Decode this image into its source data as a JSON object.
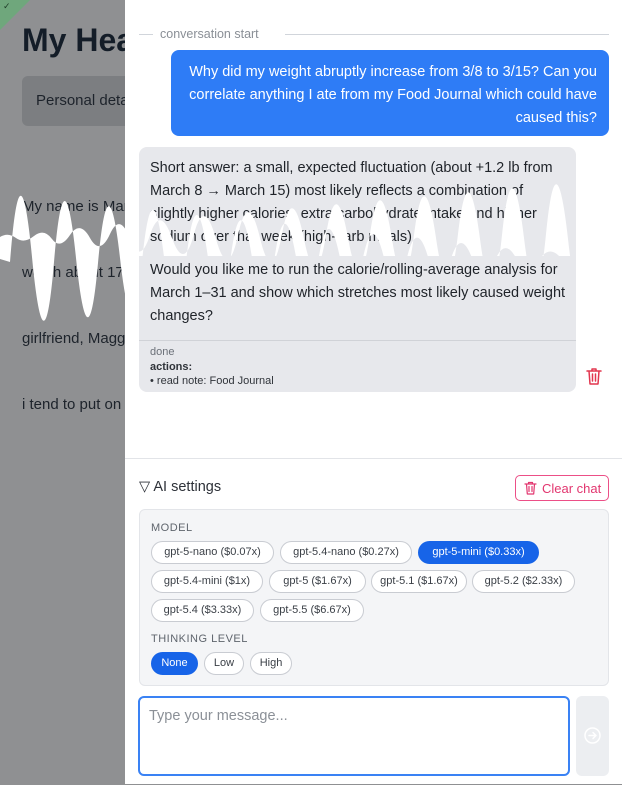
{
  "background_page": {
    "title": "My Hea",
    "tab_label": "Personal deta",
    "body_lines": [
      "My name is Mar",
      "weigh about 170",
      "girlfriend, Magg",
      "i tend to put on"
    ]
  },
  "chat": {
    "conversation_start": "conversation start",
    "user_message": "Why did my weight abruptly increase from 3/8 to 3/15? Can you correlate anything I ate from my Food Journal which could have caused this?",
    "assistant": {
      "paragraph_1": "Short answer: a small, expected fluctuation (about +1.2 lb from March 8 → March 15) most likely reflects a combination of slightly higher calories, extra carbohydrate intake and higher sodium over that week (high-carb meals)",
      "paragraph_2": "Would you like me to run the calorie/rolling-average analysis for March 1–31 and show which stretches most likely caused weight changes?",
      "status": "done",
      "actions_label": "actions:",
      "actions": [
        "• read note: Food Journal"
      ]
    }
  },
  "settings": {
    "toggle_label": "▽ AI settings",
    "clear_label": "Clear chat",
    "model_label": "MODEL",
    "models": [
      {
        "label": "gpt-5-nano ($0.07x)",
        "selected": false
      },
      {
        "label": "gpt-5.4-nano ($0.27x)",
        "selected": false
      },
      {
        "label": "gpt-5-mini ($0.33x)",
        "selected": true
      },
      {
        "label": "gpt-5.4-mini ($1x)",
        "selected": false
      },
      {
        "label": "gpt-5 ($1.67x)",
        "selected": false
      },
      {
        "label": "gpt-5.1 ($1.67x)",
        "selected": false
      },
      {
        "label": "gpt-5.2 ($2.33x)",
        "selected": false
      },
      {
        "label": "gpt-5.4 ($3.33x)",
        "selected": false
      },
      {
        "label": "gpt-5.5 ($6.67x)",
        "selected": false
      }
    ],
    "thinking_label": "THINKING LEVEL",
    "thinking_levels": [
      {
        "label": "None",
        "selected": true
      },
      {
        "label": "Low",
        "selected": false
      },
      {
        "label": "High",
        "selected": false
      }
    ]
  },
  "input": {
    "placeholder": "Type your message...",
    "value": ""
  },
  "colors": {
    "accent": "#2e7cf6",
    "selected_chip": "#1764e8",
    "danger": "#e2366f"
  }
}
